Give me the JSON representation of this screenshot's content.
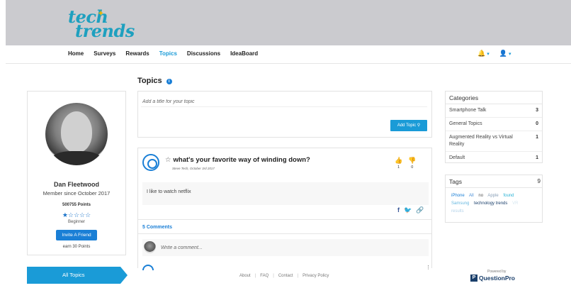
{
  "logo": {
    "line1": "tech",
    "line2": "trends",
    "spark": "✦"
  },
  "nav": {
    "items": [
      "Home",
      "Surveys",
      "Rewards",
      "Topics",
      "Discussions",
      "IdeaBoard"
    ],
    "active": "Topics",
    "bell_icon": "🔔",
    "user_icon": "👤",
    "caret": "▾"
  },
  "profile": {
    "name": "Dan Fleetwood",
    "member_since": "Member since October 2017",
    "points": "500755 Points",
    "stars": "★☆☆☆☆",
    "level": "Beginner",
    "invite_label": "Invite A Friend",
    "earn_text": "earn 30 Points"
  },
  "all_topics_label": "All Topics",
  "topics": {
    "title": "Topics",
    "info_icon": "i",
    "title_placeholder": "Add a title for your topic",
    "add_topic_label": "Add Topic ⚲"
  },
  "post": {
    "star_icon": "☆",
    "title": "what's your favorite way of winding down?",
    "meta": "Steve Tech, October 3rd 2017",
    "upvote_icon": "👍",
    "downvote_icon": "👎",
    "upvotes": "1",
    "downvotes": "0",
    "body": "I like to watch netflix",
    "facebook_icon": "f",
    "twitter_icon": "🐦",
    "link_icon": "🔗",
    "comments_label": "5 Comments",
    "comment_placeholder": "Write a comment...",
    "more_icon": "⋮"
  },
  "footer": {
    "links": [
      "About",
      "FAQ",
      "Contact",
      "Privacy Policy"
    ],
    "powered_by": "Powered by",
    "brand": "QuestionPro",
    "brand_box": "P"
  },
  "categories": {
    "title": "Categories",
    "items": [
      {
        "label": "Smartphone Talk",
        "count": "3"
      },
      {
        "label": "General Topics",
        "count": "0"
      },
      {
        "label": "Augmented Reality vs Virtual Reality",
        "count": "1"
      },
      {
        "label": "Default",
        "count": "1"
      }
    ]
  },
  "tags": {
    "title": "Tags",
    "count": "9",
    "items": [
      {
        "label": "iPhone",
        "color": "#1a7fd6"
      },
      {
        "label": "All",
        "color": "#4a8fd6"
      },
      {
        "label": "no",
        "color": "#555555"
      },
      {
        "label": "Apple",
        "color": "#8aa0b8"
      },
      {
        "label": "found",
        "color": "#2bb3d6"
      },
      {
        "label": "Samsung",
        "color": "#66b8e0"
      },
      {
        "label": "technology trends",
        "color": "#1a3f6b"
      },
      {
        "label": "VR",
        "color": "#d6e6f0"
      },
      {
        "label": "results",
        "color": "#b6d4ea"
      }
    ]
  }
}
